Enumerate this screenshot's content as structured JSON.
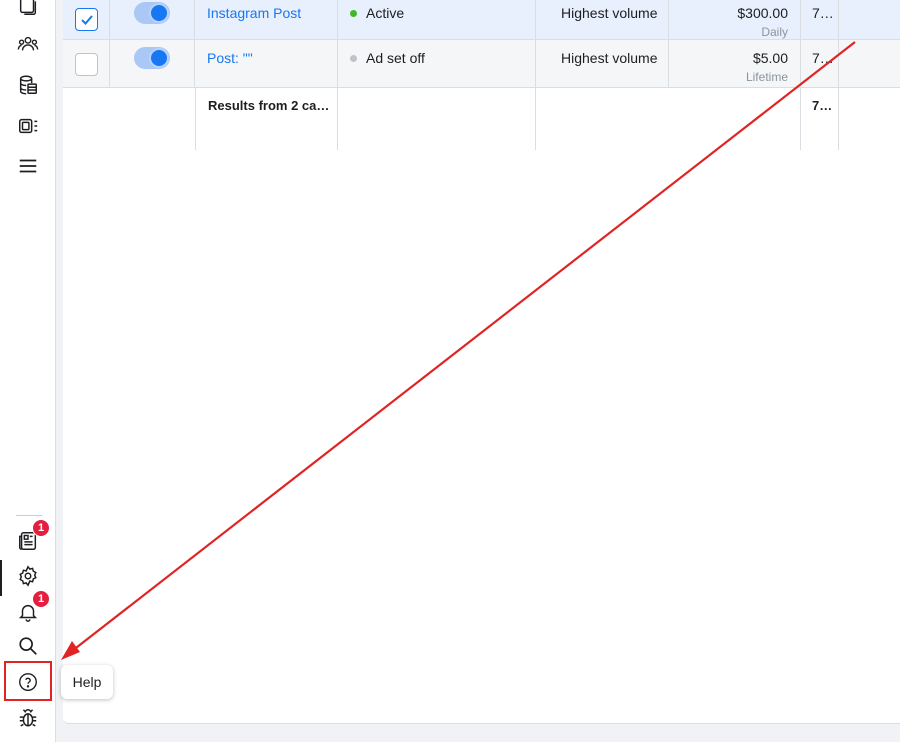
{
  "table": {
    "rows": [
      {
        "selected": true,
        "toggle_on": true,
        "name": "Instagram Post",
        "status": "Active",
        "status_color": "#42b72a",
        "bid_strategy": "Highest volume",
        "budget": "$300.00",
        "budget_type": "Daily",
        "results": "7…"
      },
      {
        "selected": false,
        "toggle_on": true,
        "name": "Post: \"\"",
        "status": "Ad set off",
        "status_color": "#bec3c9",
        "bid_strategy": "Highest volume",
        "budget": "$5.00",
        "budget_type": "Lifetime",
        "results": "7…"
      }
    ],
    "summary": {
      "label": "Results from 2 ca…",
      "results": "7…"
    }
  },
  "sidebar": {
    "items": [
      {
        "icon": "pages-icon"
      },
      {
        "icon": "audiences-icon"
      },
      {
        "icon": "database-icon"
      },
      {
        "icon": "catalog-icon"
      },
      {
        "icon": "menu-icon"
      }
    ],
    "bottom": [
      {
        "icon": "news-icon",
        "badge": "1"
      },
      {
        "icon": "gear-icon"
      },
      {
        "icon": "bell-icon",
        "badge": "1"
      },
      {
        "icon": "search-icon"
      },
      {
        "icon": "help-icon"
      },
      {
        "icon": "bug-icon"
      }
    ]
  },
  "tooltip": {
    "text": "Help"
  },
  "annotation": {
    "color": "#e02424"
  }
}
